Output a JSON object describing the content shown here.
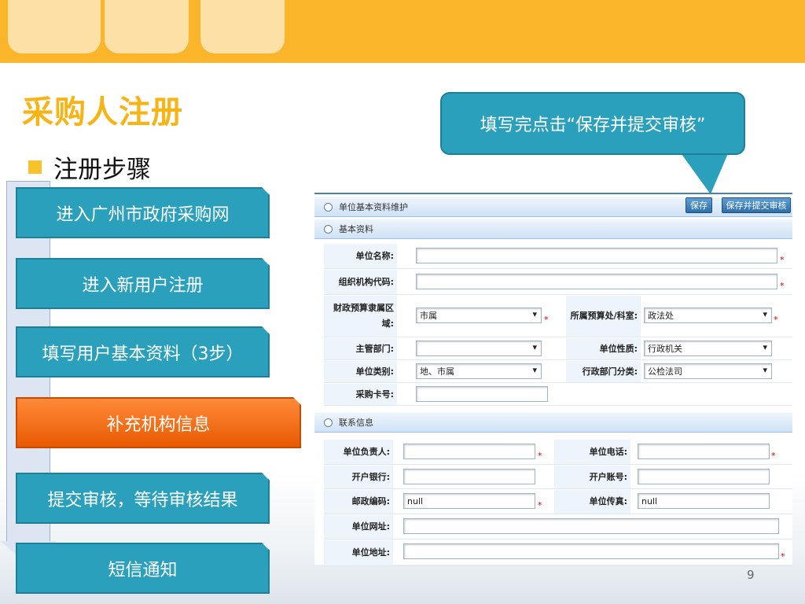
{
  "slide": {
    "title": "采购人注册",
    "subtitle": "注册步骤",
    "page_number": "9",
    "callout": "填写完点击“保存并提交审核”",
    "steps": [
      {
        "label": "进入广州市政府采购网"
      },
      {
        "label": "进入新用户注册"
      },
      {
        "label": "填写用户基本资料（3步）"
      },
      {
        "label": "补充机构信息"
      },
      {
        "label": "提交审核，等待审核结果"
      },
      {
        "label": "短信通知"
      }
    ],
    "colors": {
      "accent_orange": "#fbb52b",
      "title": "#f7b416",
      "step": "#2aa0bd",
      "active_step": "#e85a00"
    }
  },
  "form": {
    "header": "单位基本资料维护",
    "save_label": "保存",
    "submit_label": "保存并提交审核",
    "basic_header": "基本资料",
    "basic": {
      "name_label": "单位名称:",
      "code_label": "组织机构代码:",
      "region_label": "财政预算隶属区域:",
      "region_value": "市属",
      "budget_label": "所属预算处/科室:",
      "budget_value": "政法处",
      "dept_label": "主管部门:",
      "dept_value": "",
      "nature_label": "单位性质:",
      "nature_value": "行政机关",
      "category_label": "单位类别:",
      "category_value": "地、市属",
      "admin_label": "行政部门分类:",
      "admin_value": "公检法司",
      "card_label": "采购卡号:"
    },
    "contact_header": "联系信息",
    "contact": {
      "head_label": "单位负责人:",
      "phone_label": "单位电话:",
      "bank_label": "开户银行:",
      "account_label": "开户账号:",
      "zip_label": "邮政编码:",
      "zip_value": "null",
      "fax_label": "单位传真:",
      "fax_value": "null",
      "web_label": "单位网址:",
      "addr_label": "单位地址:"
    },
    "required_mark": "*"
  }
}
